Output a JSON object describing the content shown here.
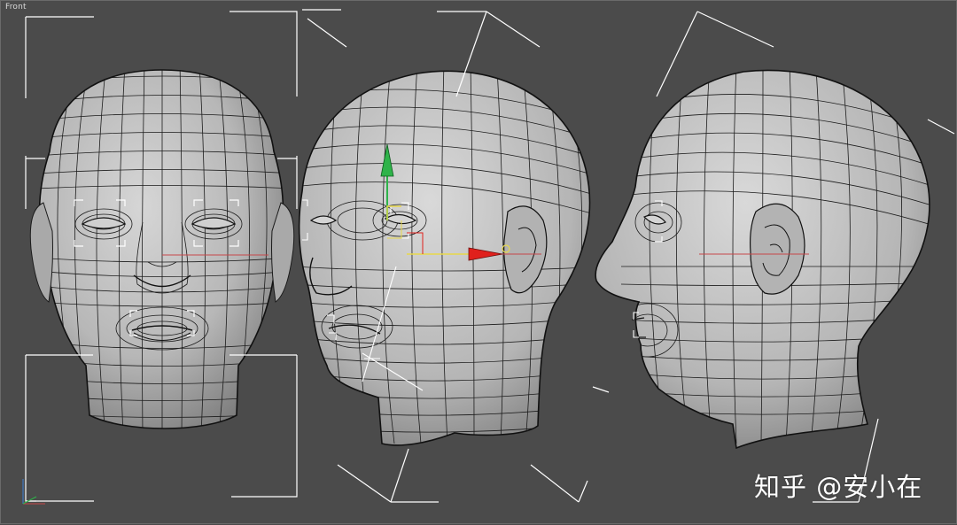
{
  "viewport": {
    "label": "Front",
    "background": "#4b4b4b",
    "wire_color": "#1a1a1a",
    "mesh_fill": "#bdbdbd",
    "bracket_color": "#ffffff"
  },
  "gizmo": {
    "y_axis_color": "#2fb34a",
    "x_axis_color": "#e0201c",
    "z_axis_color": "#e8d84a"
  },
  "watermark": {
    "text": "知乎 @安小在"
  },
  "models": [
    {
      "name": "head-front-view"
    },
    {
      "name": "head-three-quarter-view"
    },
    {
      "name": "head-side-view"
    }
  ]
}
